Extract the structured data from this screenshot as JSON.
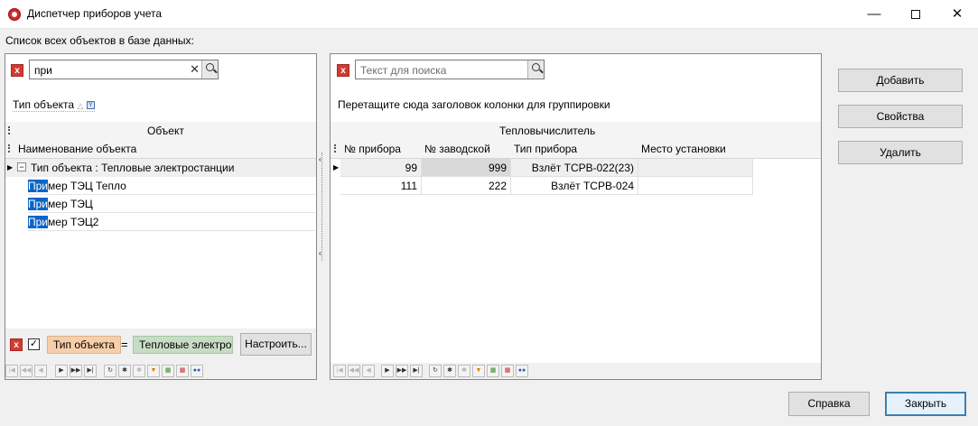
{
  "window": {
    "title": "Диспетчер приборов учета",
    "minimize": "—",
    "close": "✕"
  },
  "header_label": "Список всех объектов в базе данных:",
  "left": {
    "search": {
      "value": "при",
      "clear": "✕"
    },
    "group_by": "Тип объекта",
    "band_header": "Объект",
    "column_header": "Наименование объекта",
    "group_row": "Тип объекта : Тепловые электростанции",
    "rows": [
      {
        "match": "При",
        "rest": "мер ТЭЦ Тепло"
      },
      {
        "match": "При",
        "rest": "мер ТЭЦ"
      },
      {
        "match": "При",
        "rest": "мер ТЭЦ2"
      }
    ],
    "filter": {
      "field": "Тип объекта",
      "op": "=",
      "value": "Тепловые электрос",
      "configure": "Настроить..."
    }
  },
  "right": {
    "search": {
      "placeholder": "Текст для поиска"
    },
    "group_hint": "Перетащите сюда заголовок колонки для группировки",
    "band_header": "Тепловычислитель",
    "columns": [
      "№ прибора",
      "№ заводской",
      "Тип прибора",
      "Место установки"
    ],
    "rows": [
      [
        "99",
        "999",
        "Взлёт TCPB-022(23)",
        ""
      ],
      [
        "111",
        "222",
        "Взлёт TCPB-024",
        ""
      ]
    ]
  },
  "buttons": {
    "add": "Добавить",
    "properties": "Свойства",
    "delete": "Удалить",
    "help": "Справка",
    "close": "Закрыть"
  },
  "colors": {
    "accent": "#0a64c8",
    "close_border": "#3c7fb1",
    "clear": "#d33a32"
  }
}
